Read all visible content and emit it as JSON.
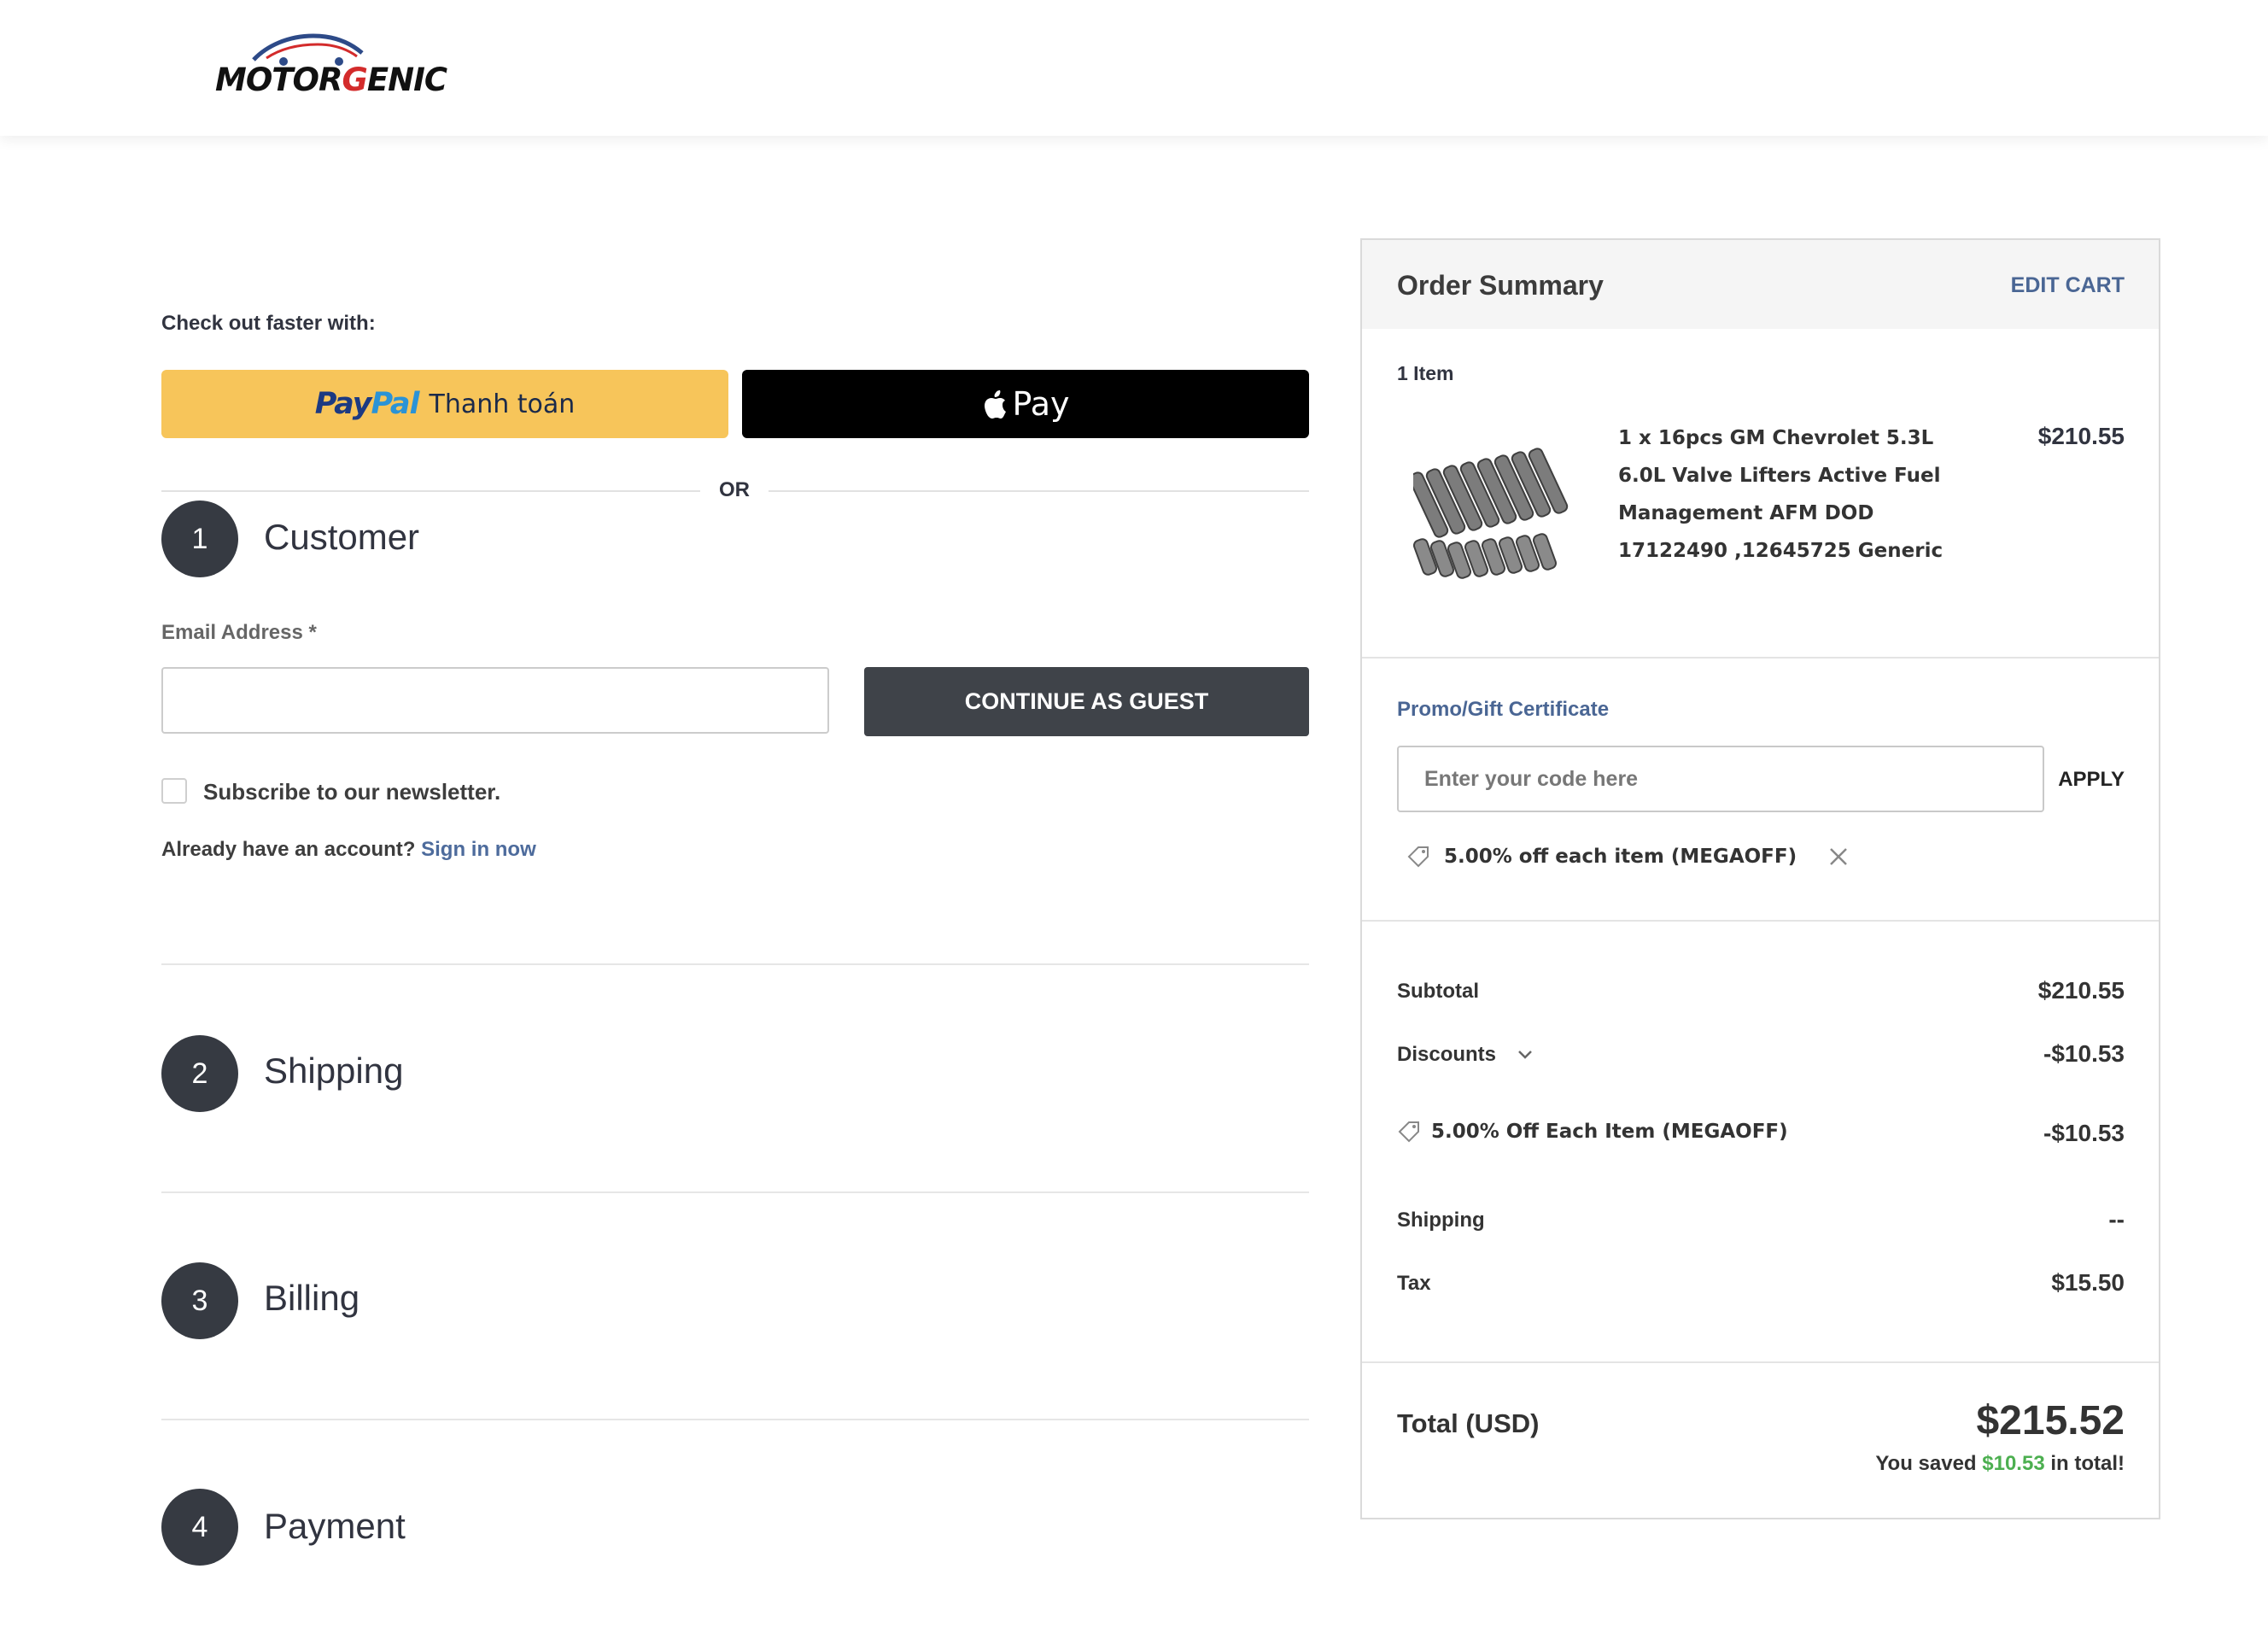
{
  "header": {
    "logo_text_a": "MOTOR",
    "logo_text_b": "G",
    "logo_text_c": "ENIC"
  },
  "checkout": {
    "faster_label": "Check out faster with:",
    "paypal_word_a": "Pay",
    "paypal_word_b": "Pal",
    "paypal_sub": "Thanh toán",
    "applepay_label": "Pay",
    "or_label": "OR",
    "steps": [
      {
        "number": "1",
        "title": "Customer"
      },
      {
        "number": "2",
        "title": "Shipping"
      },
      {
        "number": "3",
        "title": "Billing"
      },
      {
        "number": "4",
        "title": "Payment"
      }
    ],
    "email_label": "Email Address *",
    "email_value": "",
    "continue_label": "CONTINUE AS GUEST",
    "subscribe_label": "Subscribe to our newsletter.",
    "account_prompt": "Already have an account?",
    "signin_label": "Sign in now"
  },
  "summary": {
    "title": "Order Summary",
    "edit_cart": "EDIT CART",
    "items_count": "1 Item",
    "product": {
      "name": "1 x 16pcs GM Chevrolet 5.3L 6.0L Valve Lifters Active Fuel Management AFM DOD 17122490 ,12645725 Generic",
      "price": "$210.55"
    },
    "promo_label": "Promo/Gift Certificate",
    "promo_placeholder": "Enter your code here",
    "apply_label": "APPLY",
    "applied_coupon": "5.00% off each item (MEGAOFF)",
    "subtotal_label": "Subtotal",
    "subtotal_value": "$210.55",
    "discounts_label": "Discounts",
    "discounts_value": "-$10.53",
    "discount_item_label": "5.00% Off Each Item (MEGAOFF)",
    "discount_item_value": "-$10.53",
    "shipping_label": "Shipping",
    "shipping_value": "--",
    "tax_label": "Tax",
    "tax_value": "$15.50",
    "total_label": "Total (USD)",
    "total_value": "$215.52",
    "saved_prefix": "You saved",
    "saved_amount": "$10.53",
    "saved_suffix": "in total!"
  }
}
